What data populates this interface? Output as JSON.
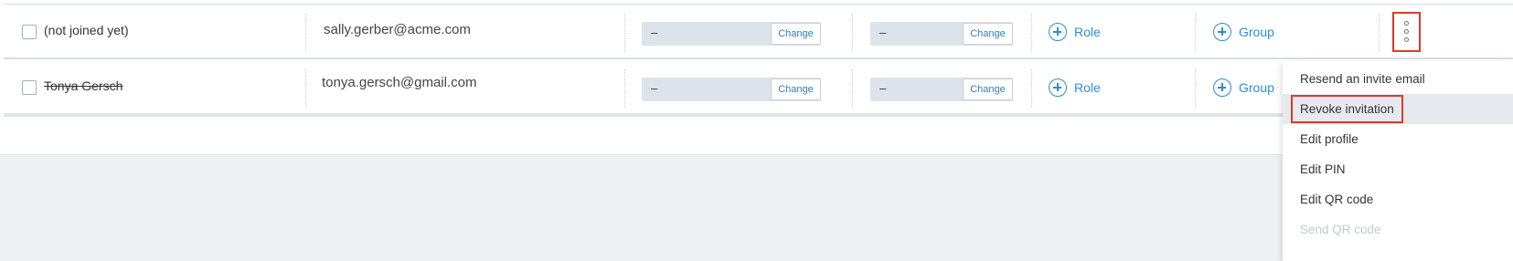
{
  "rows": [
    {
      "name": "(not joined yet)",
      "email": "sally.gerber@acme.com",
      "select1": {
        "value": "–",
        "change_label": "Change"
      },
      "select2": {
        "value": "–",
        "change_label": "Change"
      },
      "role_label": "Role",
      "group_label": "Group"
    },
    {
      "name": "Tonya Gersch",
      "email": "tonya.gersch@gmail.com",
      "select1": {
        "value": "–",
        "change_label": "Change"
      },
      "select2": {
        "value": "–",
        "change_label": "Change"
      },
      "role_label": "Role",
      "group_label": "Group"
    }
  ],
  "menu": {
    "items": [
      {
        "label": "Resend an invite email"
      },
      {
        "label": "Revoke invitation",
        "highlighted": true
      },
      {
        "label": "Edit profile"
      },
      {
        "label": "Edit PIN"
      },
      {
        "label": "Edit QR code"
      },
      {
        "label": "Send QR code",
        "disabled": true
      }
    ]
  },
  "colors": {
    "accent": "#2a8fd6",
    "highlight_border": "#d93a2c",
    "page_background": "#eef1f4"
  }
}
